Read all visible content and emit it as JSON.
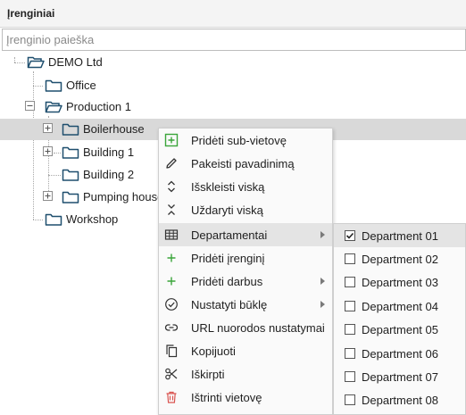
{
  "header": {
    "title": "Įrenginiai"
  },
  "search": {
    "placeholder": "Įrenginio paieška"
  },
  "tree": {
    "root": "DEMO Ltd",
    "office": "Office",
    "production": "Production 1",
    "boilerhouse": "Boilerhouse",
    "building1": "Building 1",
    "building2": "Building 2",
    "pumping": "Pumping house",
    "workshop": "Workshop"
  },
  "context_menu": {
    "items": [
      {
        "label": "Pridėti sub-vietovę",
        "icon": "add-square-icon"
      },
      {
        "label": "Pakeisti pavadinimą",
        "icon": "pencil-icon"
      },
      {
        "label": "Išskleisti viską",
        "icon": "expand-icon"
      },
      {
        "label": "Uždaryti viską",
        "icon": "collapse-icon"
      },
      {
        "label": "Departamentai",
        "icon": "grid-icon",
        "submenu": true
      },
      {
        "label": "Pridėti įrenginį",
        "icon": "plus-icon"
      },
      {
        "label": "Pridėti darbus",
        "icon": "plus-icon",
        "submenu": true
      },
      {
        "label": "Nustatyti būklę",
        "icon": "check-circle-icon",
        "submenu": true
      },
      {
        "label": "URL nuorodos nustatymai",
        "icon": "link-icon"
      },
      {
        "label": "Kopijuoti",
        "icon": "copy-icon"
      },
      {
        "label": "Iškirpti",
        "icon": "scissors-icon"
      },
      {
        "label": "Ištrinti vietovę",
        "icon": "trash-icon"
      }
    ]
  },
  "departments": [
    {
      "label": "Department 01",
      "checked": true
    },
    {
      "label": "Department 02",
      "checked": false
    },
    {
      "label": "Department 03",
      "checked": false
    },
    {
      "label": "Department 04",
      "checked": false
    },
    {
      "label": "Department 05",
      "checked": false
    },
    {
      "label": "Department 06",
      "checked": false
    },
    {
      "label": "Department 07",
      "checked": false
    },
    {
      "label": "Department 08",
      "checked": false
    }
  ],
  "colors": {
    "folder": "#1f4f6e",
    "add_green": "#3aa53a",
    "delete_red": "#d9534f",
    "selected_row": "#d9d9d9"
  }
}
